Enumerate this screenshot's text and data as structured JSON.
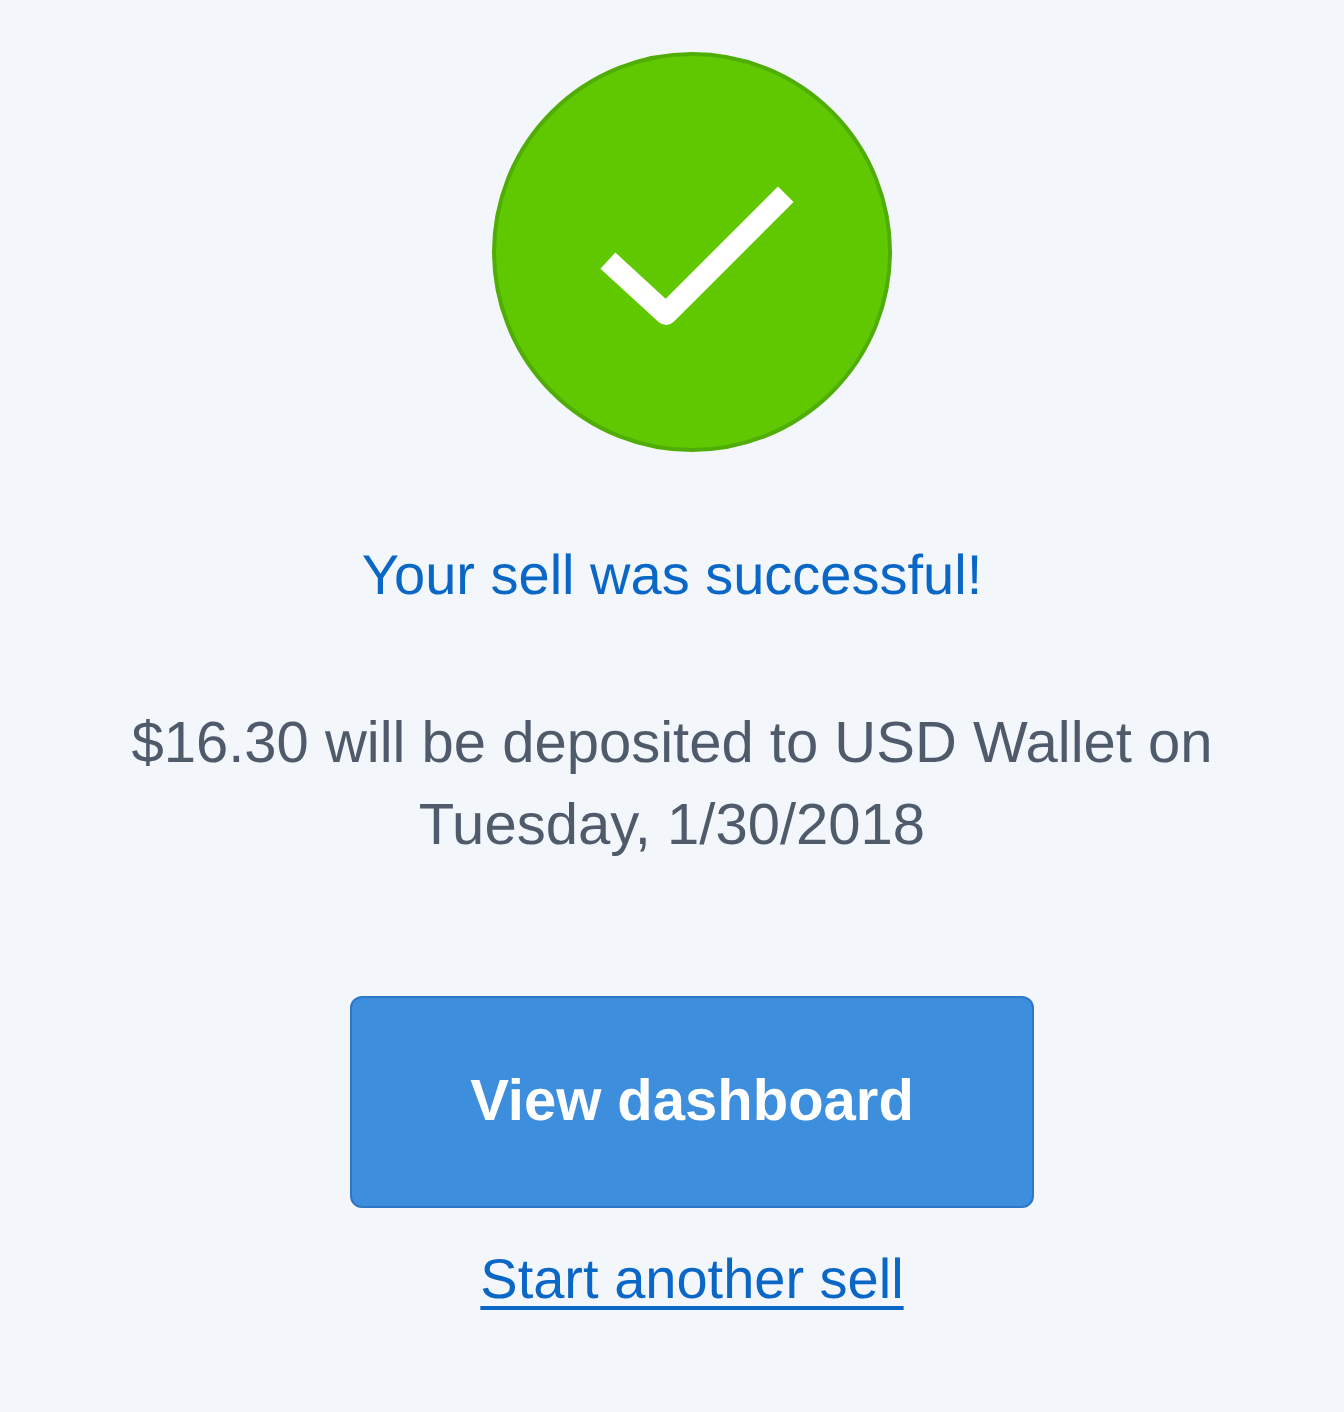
{
  "title": "Your sell was successful!",
  "message": "$16.30 will be deposited to USD Wallet on Tuesday, 1/30/2018",
  "primary_button": {
    "label": "View dashboard"
  },
  "link": {
    "label": "Start another sell"
  }
}
